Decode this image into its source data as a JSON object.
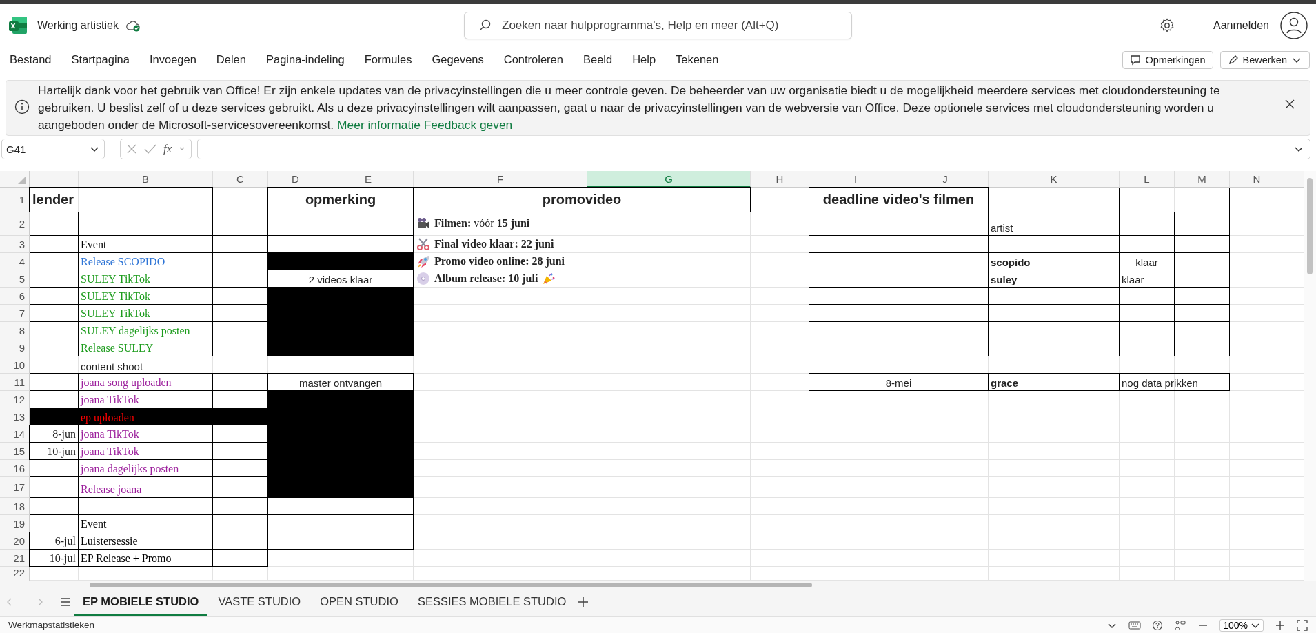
{
  "app": {
    "title": "Werking artistiek",
    "search_placeholder": "Zoeken naar hulpprogramma's, Help en meer (Alt+Q)",
    "account": "Aanmelden"
  },
  "ribbon": {
    "tabs": [
      {
        "label": "Bestand",
        "selected": false
      },
      {
        "label": "Startpagina",
        "selected": false
      },
      {
        "label": "Invoegen",
        "selected": false
      },
      {
        "label": "Delen",
        "selected": false
      },
      {
        "label": "Pagina-indeling",
        "selected": false
      },
      {
        "label": "Formules",
        "selected": false
      },
      {
        "label": "Gegevens",
        "selected": false
      },
      {
        "label": "Controleren",
        "selected": false
      },
      {
        "label": "Beeld",
        "selected": false
      },
      {
        "label": "Help",
        "selected": false
      },
      {
        "label": "Tekenen",
        "selected": false
      }
    ],
    "comments_button": "Opmerkingen",
    "edit_button": "Bewerken"
  },
  "notice": {
    "text": "Hartelijk dank voor het gebruik van Office! Er zijn enkele updates van de privacyinstellingen die u meer controle geven. De beheerder van uw organisatie biedt u de mogelijkheid meerdere services met cloudondersteuning te gebruiken. U beslist zelf of u deze services gebruikt. Als u deze privacyinstellingen wilt aanpassen, gaat u naar de privacyinstellingen van de webversie van Office. Deze optionele services met cloudondersteuning worden u aangeboden onder de Microsoft-servicesovereenkomst.",
    "links": [
      "Meer informatie",
      "Feedback geven"
    ]
  },
  "formula_bar": {
    "name_box": "G41",
    "function_label": "fx"
  },
  "sheet": {
    "columns": [
      {
        "selected": false
      },
      {
        "label": "B",
        "selected": false
      },
      {
        "label": "C",
        "selected": false
      },
      {
        "label": "D",
        "selected": false
      },
      {
        "label": "E",
        "selected": false
      },
      {
        "label": "F",
        "selected": false
      },
      {
        "label": "G",
        "selected": true
      },
      {
        "label": "H",
        "selected": false
      },
      {
        "label": "I",
        "selected": false
      },
      {
        "label": "J",
        "selected": false
      },
      {
        "label": "K",
        "selected": false
      },
      {
        "label": "L",
        "selected": false
      },
      {
        "label": "M",
        "selected": false
      },
      {
        "label": "N",
        "selected": false
      }
    ],
    "rows": [
      "1",
      "2",
      "3",
      "4",
      "5",
      "6",
      "7",
      "8",
      "9",
      "10",
      "11",
      "12",
      "13",
      "14",
      "15",
      "16",
      "17",
      "18",
      "19",
      "20",
      "21",
      "22"
    ],
    "cells": [
      {
        "kind": "heading",
        "text": "lender",
        "filled": false
      },
      {
        "kind": "heading",
        "text": "opmerking",
        "filled": false
      },
      {
        "kind": "heading",
        "text": "promovideo",
        "filled": false
      },
      {
        "kind": "heading",
        "text": "deadline video's filmen",
        "filled": false
      },
      {
        "kind": "promo",
        "text": "**Filmen:** vóór **15 juni**",
        "filled": false
      },
      {
        "kind": "promo",
        "text": "Final video klaar: 22 juni",
        "filled": false
      },
      {
        "kind": "promo",
        "text": "Promo video online: 28 juni",
        "filled": false
      },
      {
        "kind": "promo",
        "text": "Album release: 10 juli",
        "filled": false
      },
      {
        "kind": "label",
        "text": "artist",
        "filled": false
      },
      {
        "kind": "event",
        "text": "Event",
        "color": "#000000",
        "filled": false
      },
      {
        "kind": "event",
        "text": "Release SCOPIDO",
        "color": "#2f75d6",
        "filled": false
      },
      {
        "kind": "block",
        "filled": true
      },
      {
        "kind": "name",
        "text": "scopido",
        "filled": false
      },
      {
        "kind": "value",
        "text": "klaar",
        "filled": false
      },
      {
        "kind": "event",
        "text": "SULEY TikTok",
        "color": "#1e9c1e",
        "filled": false
      },
      {
        "kind": "value",
        "text": "2 videos klaar",
        "filled": false
      },
      {
        "kind": "name",
        "text": "suley",
        "filled": false
      },
      {
        "kind": "label",
        "text": "klaar",
        "filled": false
      },
      {
        "kind": "event",
        "text": "SULEY TikTok",
        "color": "#1e9c1e",
        "filled": false
      },
      {
        "kind": "block",
        "filled": true
      },
      {
        "kind": "event",
        "text": "SULEY TikTok",
        "color": "#1e9c1e",
        "filled": false
      },
      {
        "kind": "block",
        "filled": true
      },
      {
        "kind": "event",
        "text": "SULEY dagelijks posten",
        "color": "#1e9c1e",
        "filled": false
      },
      {
        "kind": "block",
        "filled": true
      },
      {
        "kind": "event",
        "text": "Release SULEY",
        "color": "#1e9c1e",
        "filled": false
      },
      {
        "kind": "block",
        "filled": true
      },
      {
        "kind": "label",
        "text": "content shoot",
        "filled": false
      },
      {
        "kind": "event",
        "text": "joana song uploaden",
        "color": "#9c1f9c",
        "filled": false
      },
      {
        "kind": "value",
        "text": "master ontvangen",
        "filled": false
      },
      {
        "kind": "value",
        "text": "8-mei",
        "filled": false
      },
      {
        "kind": "name",
        "text": "grace",
        "filled": false
      },
      {
        "kind": "label",
        "text": "nog data prikken",
        "filled": false
      },
      {
        "kind": "event",
        "text": "joana TikTok",
        "color": "#9c1f9c",
        "filled": false
      },
      {
        "kind": "block",
        "filled": true
      },
      {
        "kind": "block",
        "filled": true
      },
      {
        "kind": "event",
        "text": "ep uploaden",
        "color": "#ff0000",
        "filled": true
      },
      {
        "kind": "block",
        "filled": true
      },
      {
        "kind": "block",
        "filled": true
      },
      {
        "kind": "date",
        "text": "8-jun",
        "filled": false
      },
      {
        "kind": "event",
        "text": "joana TikTok",
        "color": "#9c1f9c",
        "filled": false
      },
      {
        "kind": "block",
        "filled": true
      },
      {
        "kind": "date",
        "text": "10-jun",
        "filled": false
      },
      {
        "kind": "event",
        "text": "joana TikTok",
        "color": "#9c1f9c",
        "filled": false
      },
      {
        "kind": "block",
        "filled": true
      },
      {
        "kind": "event",
        "text": "joana dagelijks posten",
        "color": "#9c1f9c",
        "filled": false
      },
      {
        "kind": "block",
        "filled": true
      },
      {
        "kind": "event",
        "text": "Release joana",
        "color": "#9c1f9c",
        "filled": false
      },
      {
        "kind": "block",
        "filled": true
      },
      {
        "kind": "event",
        "text": "Event",
        "color": "#000000",
        "filled": false
      },
      {
        "kind": "date",
        "text": "6-jul",
        "filled": false
      },
      {
        "kind": "event",
        "text": "Luistersessie",
        "color": "#000000",
        "filled": false
      },
      {
        "kind": "date",
        "text": "10-jul",
        "filled": false
      },
      {
        "kind": "event",
        "text": "EP Release + Promo",
        "color": "#000000",
        "filled": false
      }
    ]
  },
  "sheet_tabs": [
    {
      "label": "EP MOBIELE STUDIO",
      "selected": true
    },
    {
      "label": "VASTE STUDIO",
      "selected": false
    },
    {
      "label": "OPEN STUDIO",
      "selected": false
    },
    {
      "label": "SESSIES MOBIELE STUDIO",
      "selected": false
    }
  ],
  "status_bar": {
    "text": "Werkmapstatistieken",
    "zoom": "100%"
  }
}
